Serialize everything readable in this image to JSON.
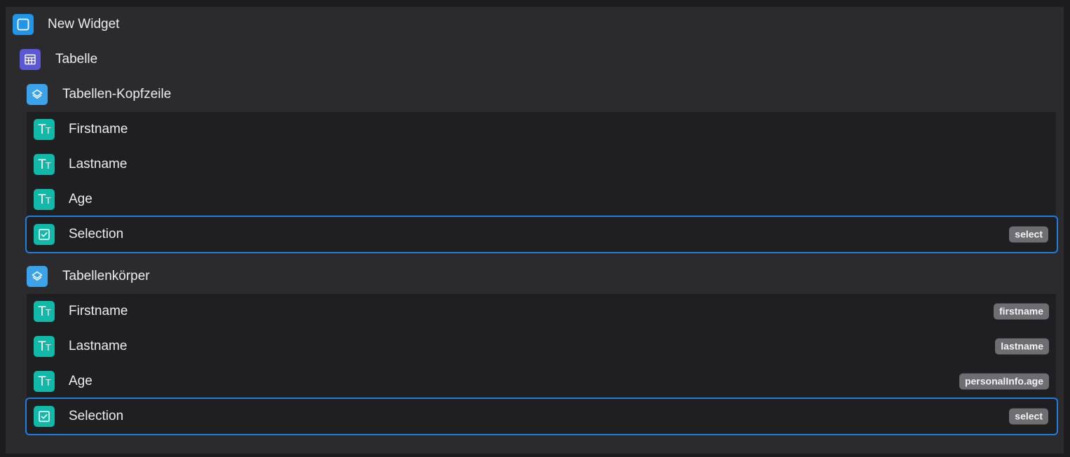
{
  "tree": {
    "root": {
      "label": "New Widget",
      "icon": "widget-icon"
    },
    "table": {
      "label": "Tabelle",
      "icon": "table-icon"
    },
    "header_group": {
      "label": "Tabellen-Kopfzeile",
      "icon": "layers-icon",
      "items": [
        {
          "label": "Firstname",
          "icon": "text-icon",
          "badge": ""
        },
        {
          "label": "Lastname",
          "icon": "text-icon",
          "badge": ""
        },
        {
          "label": "Age",
          "icon": "text-icon",
          "badge": ""
        },
        {
          "label": "Selection",
          "icon": "checkbox-icon",
          "badge": "select"
        }
      ]
    },
    "body_group": {
      "label": "Tabellenkörper",
      "icon": "layers-icon",
      "items": [
        {
          "label": "Firstname",
          "icon": "text-icon",
          "badge": "firstname"
        },
        {
          "label": "Lastname",
          "icon": "text-icon",
          "badge": "lastname"
        },
        {
          "label": "Age",
          "icon": "text-icon",
          "badge": "personalInfo.age"
        },
        {
          "label": "Selection",
          "icon": "checkbox-icon",
          "badge": "select"
        }
      ]
    }
  },
  "colors": {
    "background": "#1c1c1e",
    "panel": "#2b2b2e",
    "selection_border": "#1e7fe0",
    "text_icon": "#10b9a8",
    "layer_icon": "#3aa3ea",
    "table_icon": "#5b58d6",
    "widget_icon": "#2196e8",
    "badge": "#6d6d72"
  }
}
